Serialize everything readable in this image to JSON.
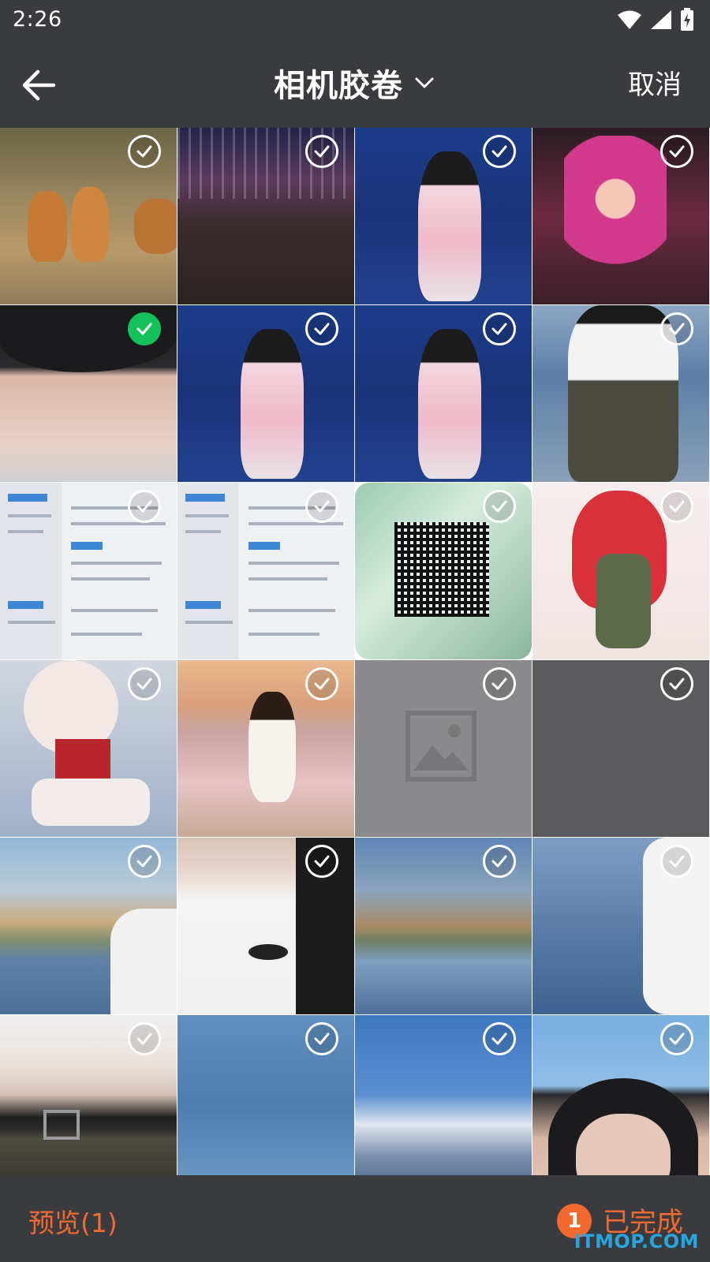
{
  "status_bar": {
    "time": "2:26",
    "icons": [
      "wifi-icon",
      "signal-icon",
      "battery-charging-icon"
    ]
  },
  "app_bar": {
    "title": "相机胶卷",
    "cancel_label": "取消",
    "back_icon": "arrow-left-icon",
    "title_dropdown_icon": "chevron-down-icon"
  },
  "grid": {
    "items": [
      {
        "name": "photo-tigers",
        "selected": false
      },
      {
        "name": "photo-street-crowd",
        "selected": false
      },
      {
        "name": "photo-girl-sea-1",
        "selected": false
      },
      {
        "name": "photo-pink-hair",
        "selected": false
      },
      {
        "name": "photo-girl-hat",
        "selected": true
      },
      {
        "name": "photo-girl-sea-2",
        "selected": false
      },
      {
        "name": "photo-girl-sea-3",
        "selected": false
      },
      {
        "name": "photo-girl-lake",
        "selected": false
      },
      {
        "name": "photo-resume-1",
        "selected": false
      },
      {
        "name": "photo-resume-2",
        "selected": false
      },
      {
        "name": "photo-qr-code",
        "selected": false
      },
      {
        "name": "photo-anime-red-hair",
        "selected": false
      },
      {
        "name": "photo-anime-white-hair",
        "selected": false
      },
      {
        "name": "photo-girl-flower-field",
        "selected": false
      },
      {
        "name": "photo-placeholder",
        "selected": false
      },
      {
        "name": "photo-blank",
        "selected": false
      },
      {
        "name": "photo-lake-mountain-1",
        "selected": false
      },
      {
        "name": "photo-white-shirt",
        "selected": false
      },
      {
        "name": "photo-lake-mountain-2",
        "selected": false
      },
      {
        "name": "photo-lake-branch",
        "selected": false
      },
      {
        "name": "photo-belt",
        "selected": false
      },
      {
        "name": "photo-water",
        "selected": false
      },
      {
        "name": "photo-sky-mountain",
        "selected": false
      },
      {
        "name": "photo-portrait",
        "selected": false
      }
    ]
  },
  "bottom_bar": {
    "preview_label": "预览(1)",
    "selected_count": "1",
    "done_label": "已完成"
  },
  "watermark": "ITMOP.COM",
  "colors": {
    "accent": "#f26a2f",
    "selected_check": "#15c15a",
    "bar_background": "#3a3b3f"
  }
}
